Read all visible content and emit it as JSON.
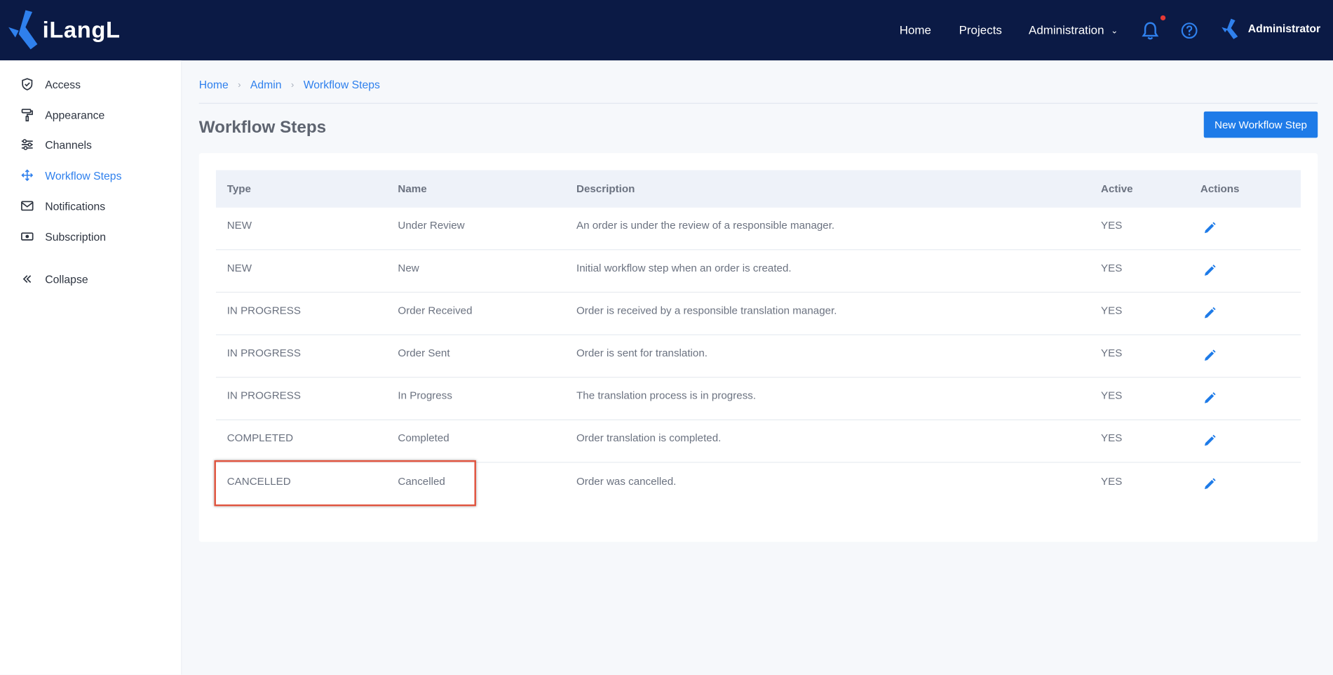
{
  "app": {
    "logo_text": "iLangL"
  },
  "topnav": {
    "home": "Home",
    "projects": "Projects",
    "administration": "Administration",
    "user_name": "Administrator"
  },
  "sidebar": {
    "items": [
      {
        "label": "Access",
        "icon": "shield-icon"
      },
      {
        "label": "Appearance",
        "icon": "paint-roller-icon"
      },
      {
        "label": "Channels",
        "icon": "sliders-icon"
      },
      {
        "label": "Workflow Steps",
        "icon": "workflow-icon"
      },
      {
        "label": "Notifications",
        "icon": "mail-icon"
      },
      {
        "label": "Subscription",
        "icon": "money-icon"
      }
    ],
    "collapse": "Collapse"
  },
  "breadcrumb": [
    "Home",
    "Admin",
    "Workflow Steps"
  ],
  "page_title": "Workflow Steps",
  "new_button": "New Workflow Step",
  "table": {
    "headers": [
      "Type",
      "Name",
      "Description",
      "Active",
      "Actions"
    ],
    "rows": [
      [
        "NEW",
        "Under Review",
        "An order is under the review of a responsible manager.",
        "YES"
      ],
      [
        "NEW",
        "New",
        "Initial workflow step when an order is created.",
        "YES"
      ],
      [
        "IN PROGRESS",
        "Order Received",
        "Order is received by a responsible translation manager.",
        "YES"
      ],
      [
        "IN PROGRESS",
        "Order Sent",
        "Order is sent for translation.",
        "YES"
      ],
      [
        "IN PROGRESS",
        "In Progress",
        "The translation process is in progress.",
        "YES"
      ],
      [
        "COMPLETED",
        "Completed",
        "Order translation is completed.",
        "YES"
      ],
      [
        "CANCELLED",
        "Cancelled",
        "Order was cancelled.",
        "YES"
      ]
    ]
  },
  "colors": {
    "topbar": "#0b1a45",
    "accent": "#2f80ed",
    "button": "#1e7be8",
    "highlight": "#e0533d"
  }
}
